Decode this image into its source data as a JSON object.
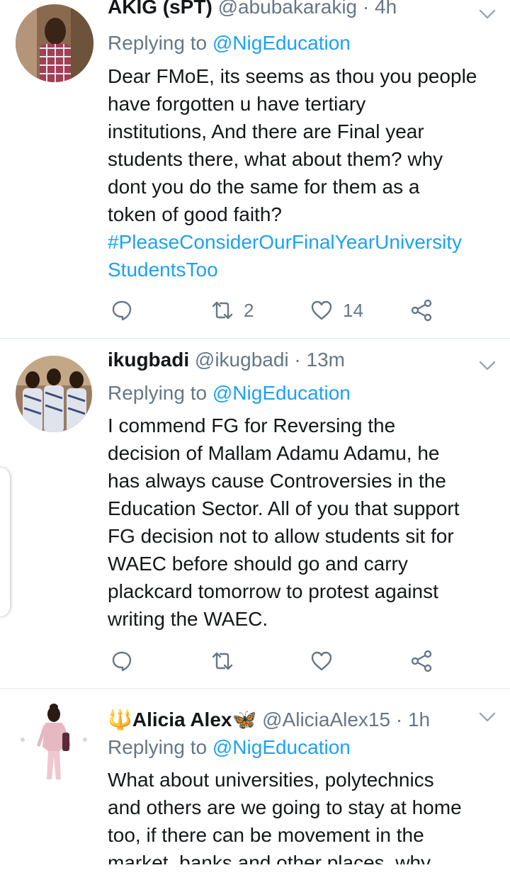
{
  "tweets": [
    {
      "name": "AKIG (sPT)",
      "handle": "@abubakarakig",
      "time": "4h",
      "replying_label": "Replying to",
      "replying_to": "@NigEducation",
      "text_lines": [
        "Dear FMoE, its seems as thou you people",
        "have forgotten u have tertiary",
        "institutions, And there are Final year",
        "students there, what about them? why",
        "dont you do the same for them as a",
        "token of good faith?"
      ],
      "hashtag_lines": [
        "#PleaseConsiderOurFinalYearUniversity",
        "StudentsToo"
      ],
      "retweets": "2",
      "likes": "14"
    },
    {
      "name": "ikugbadi",
      "handle": "@ikugbadi",
      "time": "13m",
      "replying_label": "Replying to",
      "replying_to": "@NigEducation",
      "text_lines": [
        "I commend FG for Reversing the",
        "decision of Mallam Adamu Adamu, he",
        "has always cause Controversies in the",
        "Education Sector.  All of you that support",
        "FG decision not to allow students sit for",
        "WAEC before should go and carry",
        "plackcard tomorrow to protest against",
        "writing the WAEC."
      ],
      "retweets": "",
      "likes": ""
    },
    {
      "name": "Alicia Alex",
      "name_prefix_emoji": "🔱",
      "name_suffix_emoji": "🦋",
      "handle": "@AliciaAlex15",
      "time": "1h",
      "replying_label": "Replying to",
      "replying_to": "@NigEducation",
      "text_lines": [
        "What about universities, polytechnics",
        "and others are we going to stay at home",
        "too, if there can be movement in the",
        "market, banks and other places, why"
      ]
    }
  ],
  "separator": "·",
  "colors": {
    "link": "#1da1f2",
    "secondary": "#657786",
    "primary": "#14171a",
    "divider": "#e1e8ed"
  },
  "icons": [
    "reply-icon",
    "retweet-icon",
    "like-icon",
    "share-icon",
    "chevron-down-icon"
  ]
}
